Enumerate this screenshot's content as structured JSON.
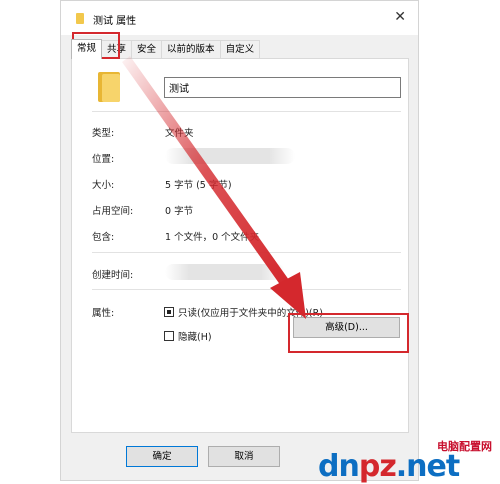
{
  "window": {
    "title": "测试 属性",
    "close_glyph": "✕"
  },
  "tabs": [
    {
      "label": "常规",
      "active": true
    },
    {
      "label": "共享"
    },
    {
      "label": "安全"
    },
    {
      "label": "以前的版本"
    },
    {
      "label": "自定义"
    }
  ],
  "general": {
    "folder_name": "测试",
    "type_label": "类型:",
    "type_value": "文件夹",
    "location_label": "位置:",
    "size_label": "大小:",
    "size_value": "5 字节 (5 字节)",
    "size_on_disk_label": "占用空间:",
    "size_on_disk_value": "0 字节",
    "contains_label": "包含:",
    "contains_value": "1 个文件，0 个文件夹",
    "created_label": "创建时间:",
    "attributes_label": "属性:",
    "readonly_label": "只读(仅应用于文件夹中的文件)(R)",
    "readonly_state": "indeterminate",
    "hidden_label": "隐藏(H)",
    "hidden_checked": false,
    "advanced_button": "高级(D)..."
  },
  "footer": {
    "ok_label": "确定",
    "cancel_label": "取消"
  },
  "watermark": {
    "site": "电脑配置网",
    "logo_a": "dn",
    "logo_b": "pz",
    "logo_c": ".net"
  },
  "colors": {
    "highlight": "#d4282d",
    "arrow": "#d4282d",
    "folder": "#f2c84c",
    "watermark_blue": "#0d6ec2"
  }
}
